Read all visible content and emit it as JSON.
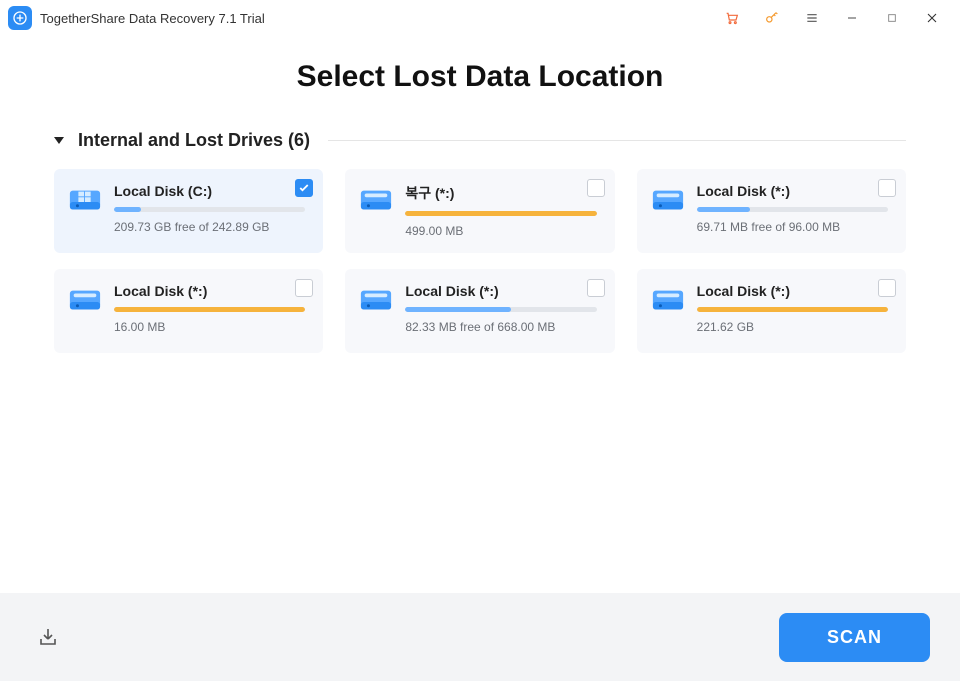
{
  "app": {
    "title": "TogetherShare Data Recovery 7.1 Trial"
  },
  "page": {
    "heading": "Select Lost Data Location",
    "section_label": "Internal and Lost Drives (6)"
  },
  "drives": [
    {
      "name": "Local Disk (C:)",
      "sub": "209.73 GB free of 242.89 GB",
      "fill_pct": 14,
      "color": "#6fb3ff",
      "selected": true,
      "icon": "win"
    },
    {
      "name": "복구 (*:)",
      "sub": "499.00 MB",
      "fill_pct": 100,
      "color": "#f6b33c",
      "selected": false,
      "icon": "disk"
    },
    {
      "name": "Local Disk (*:)",
      "sub": "69.71 MB free of 96.00 MB",
      "fill_pct": 28,
      "color": "#6fb3ff",
      "selected": false,
      "icon": "disk"
    },
    {
      "name": "Local Disk (*:)",
      "sub": "16.00 MB",
      "fill_pct": 100,
      "color": "#f6b33c",
      "selected": false,
      "icon": "disk"
    },
    {
      "name": "Local Disk (*:)",
      "sub": "82.33 MB free of 668.00 MB",
      "fill_pct": 55,
      "color": "#6fb3ff",
      "selected": false,
      "icon": "disk"
    },
    {
      "name": "Local Disk (*:)",
      "sub": "221.62 GB",
      "fill_pct": 100,
      "color": "#f6b33c",
      "selected": false,
      "icon": "disk"
    }
  ],
  "footer": {
    "scan_label": "SCAN"
  }
}
